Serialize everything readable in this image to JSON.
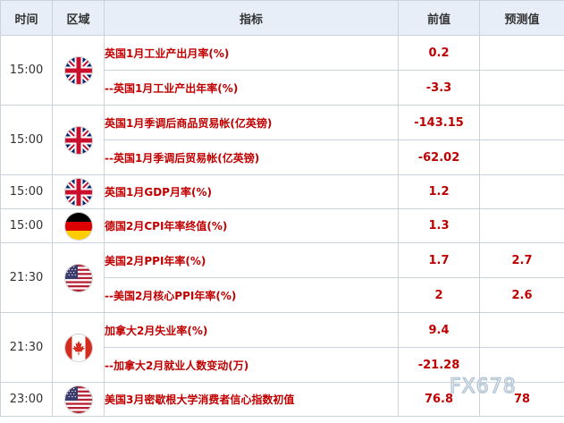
{
  "header": {
    "time": "时间",
    "area": "区域",
    "indicator": "指标",
    "previous": "前值",
    "forecast": "预测值"
  },
  "flags": {
    "uk": {
      "name": "uk-flag-icon",
      "label": "英国"
    },
    "de": {
      "name": "germany-flag-icon",
      "label": "德国"
    },
    "us": {
      "name": "usa-flag-icon",
      "label": "美国"
    },
    "ca": {
      "name": "canada-flag-icon",
      "label": "加拿大"
    }
  },
  "events": [
    {
      "time": "15:00",
      "flag": "uk",
      "rows": [
        {
          "indicator": "英国1月工业产出月率(%)",
          "previous": "0.2",
          "forecast": ""
        },
        {
          "indicator": "--英国1月工业产出年率(%)",
          "previous": "-3.3",
          "forecast": ""
        }
      ]
    },
    {
      "time": "15:00",
      "flag": "uk",
      "rows": [
        {
          "indicator": "英国1月季调后商品贸易帐(亿英镑)",
          "previous": "-143.15",
          "forecast": ""
        },
        {
          "indicator": "--英国1月季调后贸易帐(亿英镑)",
          "previous": "-62.02",
          "forecast": ""
        }
      ]
    },
    {
      "time": "15:00",
      "flag": "uk",
      "rows": [
        {
          "indicator": "英国1月GDP月率(%)",
          "previous": "1.2",
          "forecast": ""
        }
      ]
    },
    {
      "time": "15:00",
      "flag": "de",
      "rows": [
        {
          "indicator": "德国2月CPI年率终值(%)",
          "previous": "1.3",
          "forecast": ""
        }
      ]
    },
    {
      "time": "21:30",
      "flag": "us",
      "rows": [
        {
          "indicator": "美国2月PPI年率(%)",
          "previous": "1.7",
          "forecast": "2.7"
        },
        {
          "indicator": "--美国2月核心PPI年率(%)",
          "previous": "2",
          "forecast": "2.6"
        }
      ]
    },
    {
      "time": "21:30",
      "flag": "ca",
      "rows": [
        {
          "indicator": "加拿大2月失业率(%)",
          "previous": "9.4",
          "forecast": ""
        },
        {
          "indicator": "--加拿大2月就业人数变动(万)",
          "previous": "-21.28",
          "forecast": ""
        }
      ]
    },
    {
      "time": "23:00",
      "flag": "us",
      "rows": [
        {
          "indicator": "美国3月密歇根大学消费者信心指数初值",
          "previous": "76.8",
          "forecast": "78"
        }
      ]
    }
  ],
  "watermark": "FX678"
}
